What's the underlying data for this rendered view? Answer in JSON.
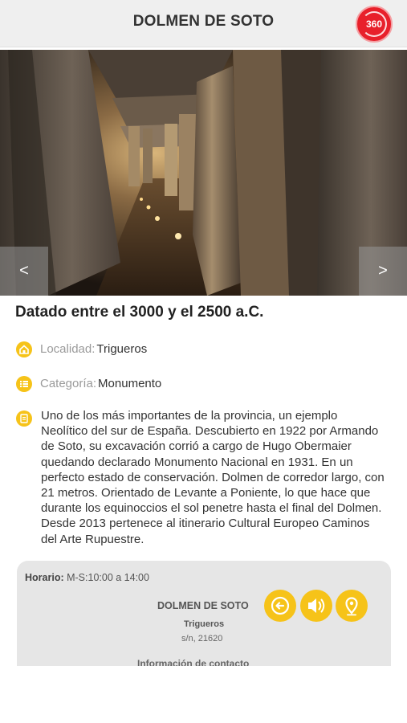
{
  "header": {
    "title": "DOLMEN DE SOTO",
    "btn_360_label": "360"
  },
  "gallery": {
    "prev_label": "<",
    "next_label": ">"
  },
  "detail": {
    "date_title": "Datado entre el 3000 y el 2500 a.C.",
    "locality_label": "Localidad:",
    "locality_value": "Trigueros",
    "category_label": "Categoría:",
    "category_value": "Monumento",
    "description": "Uno de los más importantes de la provincia, un ejemplo Neolítico del sur de España. Descubierto en 1922 por Armando de Soto, su excavación corrió a cargo de Hugo Obermaier quedando declarado Monumento Nacional en 1931. En un perfecto estado de conservación. Dolmen de corredor largo, con 21 metros. Orientado de Levante a Poniente, lo que hace que durante los equinoccios el  sol penetre hasta el final del Dolmen. Desde 2013 pertenece al itinerario  Cultural Europeo Caminos del Arte Rupuestre."
  },
  "card": {
    "hours_label": "Horario:",
    "hours_value": "M-S:10:00 a 14:00",
    "name": "DOLMEN DE SOTO",
    "town": "Trigueros",
    "address": "s/n, 21620",
    "cut_text": "Información de contacto"
  },
  "colors": {
    "accent": "#f6c319",
    "badge_red": "#e8202b",
    "header_bg": "#efefef",
    "card_bg": "#e6e6e6"
  },
  "icons": {
    "btn_360": "360-view-icon",
    "locality": "home-icon",
    "category": "list-icon",
    "description": "document-icon",
    "back": "arrow-left-icon",
    "audio": "speaker-icon",
    "map": "map-pin-icon"
  }
}
